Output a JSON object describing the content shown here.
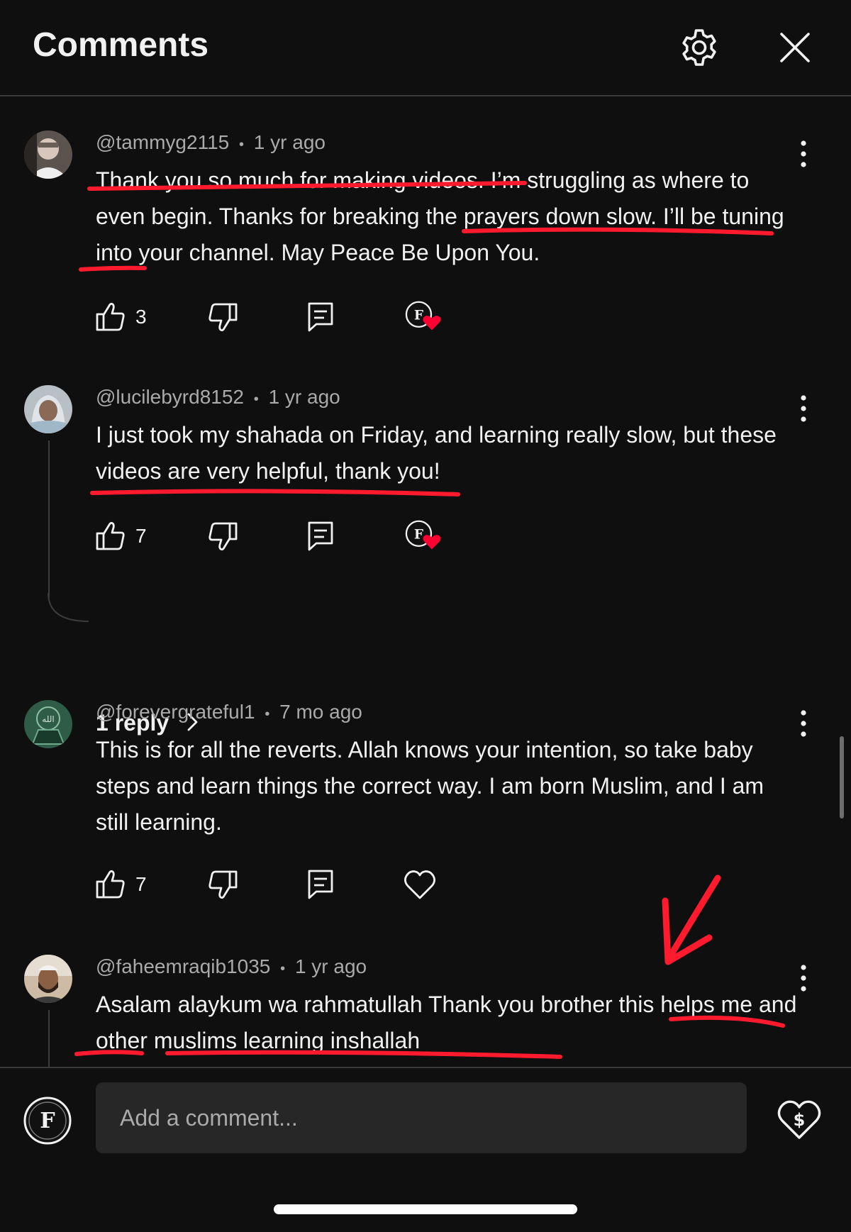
{
  "header": {
    "title": "Comments",
    "settings_icon": "gear-icon",
    "close_icon": "close-icon"
  },
  "comments": [
    {
      "author": "@tammyg2115",
      "time": "1 yr ago",
      "text": "Thank you so much for making videos. I’m struggling as where to even begin. Thanks for breaking the prayers down slow. I’ll be tuning into your channel. May Peace Be Upon You.",
      "likes": "3",
      "creator_hearted": true
    },
    {
      "author": "@lucilebyrd8152",
      "time": "1 yr ago",
      "text": "I just took my shahada on Friday, and learning really slow, but these videos are very helpful, thank you!",
      "likes": "7",
      "creator_hearted": true,
      "replies_label": "1 reply"
    },
    {
      "author": "@forevergrateful1",
      "time": "7 mo ago",
      "text": "This is for all the reverts. Allah knows your intention, so take baby steps and learn things the correct way. I am born Muslim, and I am still learning.",
      "likes": "7",
      "creator_hearted": false
    },
    {
      "author": "@faheemraqib1035",
      "time": "1 yr ago",
      "text": "Asalam alaykum wa rahmatullah Thank you brother this helps me and other muslims learning inshallah"
    }
  ],
  "meta_separator": "•",
  "composer": {
    "placeholder": "Add a comment...",
    "thanks_icon": "super-thanks-heart-dollar-icon"
  },
  "colors": {
    "background": "#0f0f0f",
    "text": "#f1f1f1",
    "secondary_text": "#aaaaaa",
    "annotation_red": "#ff1a2e",
    "heart_red": "#ff0033"
  }
}
